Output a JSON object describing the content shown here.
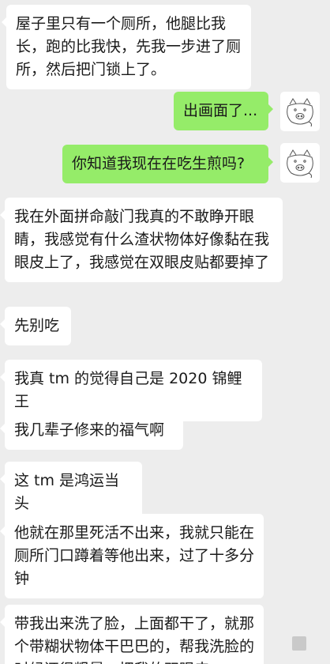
{
  "conversation": {
    "messages": [
      {
        "side": "left",
        "text": "屋子里只有一个厕所，他腿比我长，跑的比我快，先我一步进了厕所，然后把门锁上了。"
      },
      {
        "side": "right",
        "text": "出画面了..."
      },
      {
        "side": "right",
        "text": "你知道我现在在吃生煎吗?"
      },
      {
        "side": "left",
        "text": "我在外面拼命敲门我真的不敢睁开眼睛，我感觉有什么渣状物体好像黏在我眼皮上了，我感觉在双眼皮贴都要掉了"
      },
      {
        "side": "left",
        "text": "先别吃"
      },
      {
        "side": "left",
        "text": "我真 tm 的觉得自己是 2020 锦鲤王"
      },
      {
        "side": "left",
        "text": "我几辈子修来的福气啊"
      },
      {
        "side": "left",
        "text": "这 tm 是鸿运当头"
      },
      {
        "side": "left",
        "text": "他就在那里死活不出来，我就只能在厕所门口蹲着等他出来，过了十多分钟"
      },
      {
        "side": "left",
        "text": "带我出来洗了脸，上面都干了，就那个带糊状物体干巴巴的，帮我洗脸的时候还很粗暴，把我的双眼皮"
      }
    ]
  },
  "avatars": {
    "self_icon": "pig-sketch-icon"
  },
  "colors": {
    "background": "#ededed",
    "left_bubble": "#ffffff",
    "right_bubble": "#95ec69"
  }
}
